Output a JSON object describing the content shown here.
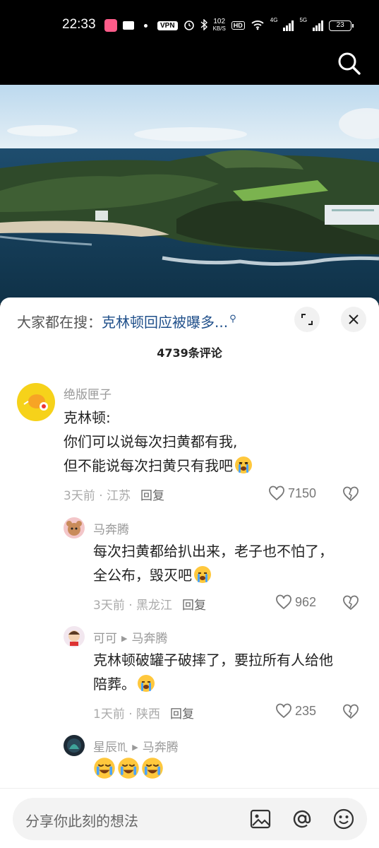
{
  "status": {
    "time": "22:33",
    "vpn": "VPN",
    "speed_value": "102",
    "speed_unit": "KB/S",
    "hd": "HD",
    "net1": "4G",
    "net2": "5G",
    "battery": "23"
  },
  "hot_search": {
    "prefix": "大家都在搜：",
    "query": "克林顿回应被曝多..."
  },
  "comment_count": "4739条评论",
  "comments": [
    {
      "author": "绝版匣子",
      "lines": [
        "克林顿:",
        "你们可以说每次扫黄都有我,",
        "但不能说每次扫黄只有我吧"
      ],
      "time": "3天前",
      "location": "江苏",
      "reply": "回复",
      "likes": "7150"
    },
    {
      "author": "马奔腾",
      "lines": [
        "每次扫黄都给扒出来，老子也不怕了，",
        "全公布，毁灭吧"
      ],
      "time": "3天前",
      "location": "黑龙江",
      "reply": "回复",
      "likes": "962"
    },
    {
      "author": "可可",
      "reply_to": "马奔腾",
      "lines": [
        "克林顿破罐子破摔了，要拉所有人给他",
        "陪葬。"
      ],
      "time": "1天前",
      "location": "陕西",
      "reply": "回复",
      "likes": "235"
    },
    {
      "author": "星辰♏",
      "reply_to": "马奔腾",
      "lines": [
        ""
      ]
    }
  ],
  "input": {
    "placeholder": "分享你此刻的想法"
  },
  "icons": [
    "search-icon",
    "expand-icon",
    "close-icon",
    "heart-icon",
    "dislike-heart-icon",
    "image-icon",
    "at-icon",
    "emoji-icon",
    "crying-emoji"
  ],
  "colors": {
    "hot_query": "#1f4f8a",
    "sheet_bg": "#ffffff"
  }
}
